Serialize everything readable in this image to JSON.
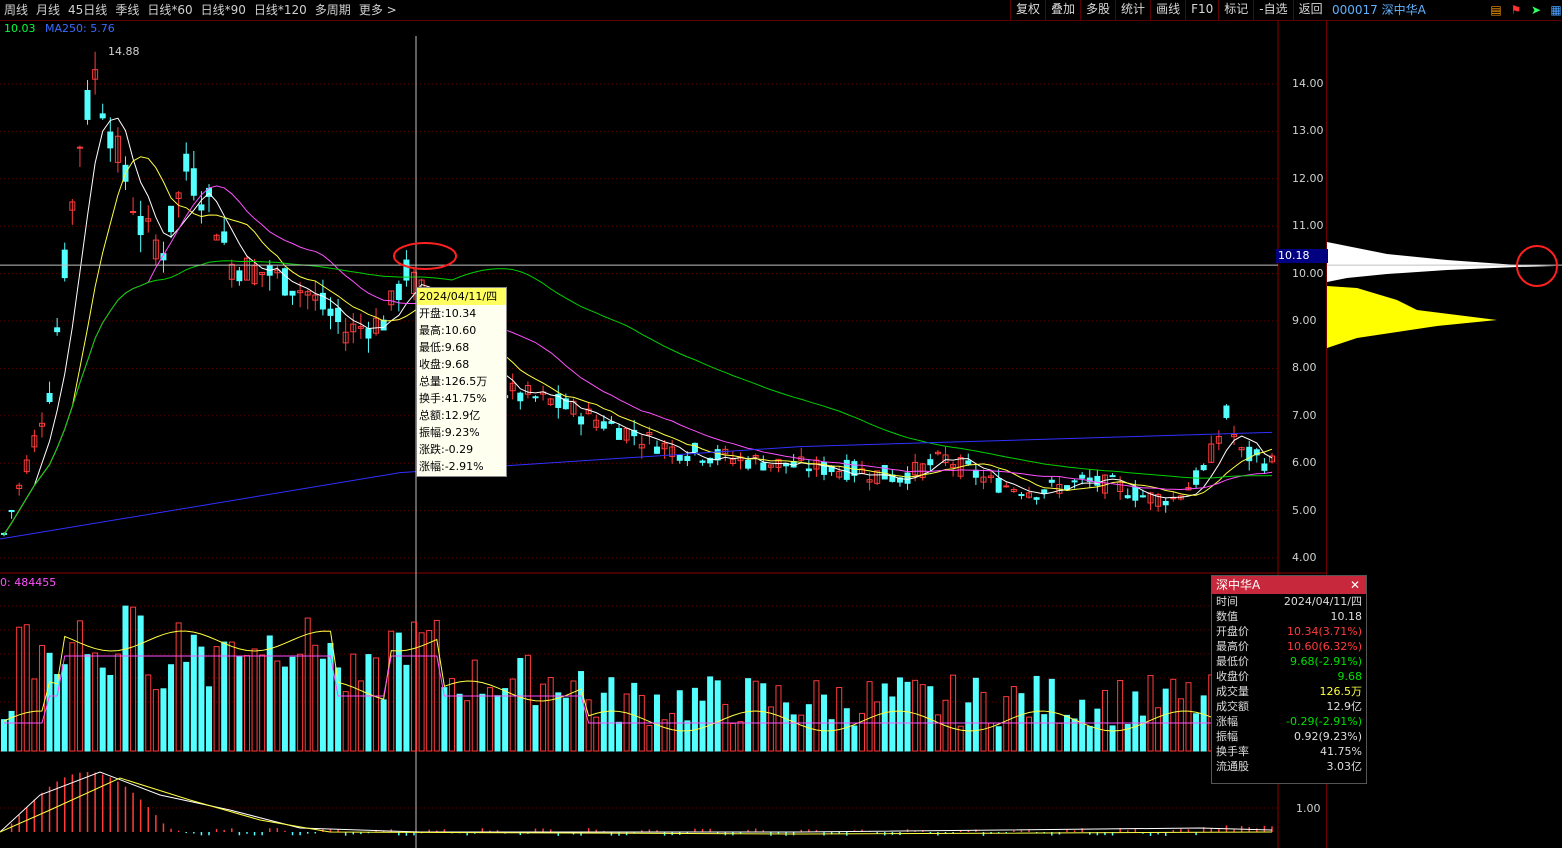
{
  "periods": [
    "周线",
    "月线",
    "45日线",
    "季线",
    "日线*60",
    "日线*90",
    "日线*120",
    "多周期",
    "更多 >"
  ],
  "toolbar": [
    "复权",
    "叠加",
    "多股",
    "统计",
    "画线",
    "F10",
    "标记",
    "-自选",
    "返回"
  ],
  "stock": {
    "code_name": "000017 深中华A"
  },
  "ma_legend": {
    "value": "10.03",
    "ma250": "MA250: 5.76"
  },
  "price_axis": [
    "14.00",
    "13.00",
    "12.00",
    "11.00",
    "10.00",
    "9.00",
    "8.00",
    "7.00",
    "6.00",
    "5.00",
    "4.00"
  ],
  "cursor_value": "10.18",
  "peak_label": "14.88",
  "volume_label": "0: 484455",
  "indicator_axis": [
    "1.00"
  ],
  "tooltip": {
    "date": "2024/04/11/四",
    "rows": [
      "开盘:10.34",
      "最高:10.60",
      "最低:9.68",
      "收盘:9.68",
      "总量:126.5万",
      "换手:41.75%",
      "总额:12.9亿",
      "振幅:9.23%",
      "涨跌:-0.29",
      "涨幅:-2.91%"
    ]
  },
  "info_panel": {
    "title": "深中华A",
    "close": "✕",
    "rows": [
      {
        "k": "时间",
        "v": "2024/04/11/四",
        "color": "#dddddd"
      },
      {
        "k": "数值",
        "v": "10.18",
        "color": "#dddddd"
      },
      {
        "k": "开盘价",
        "v": "10.34(3.71%)",
        "color": "#ff3c3c"
      },
      {
        "k": "最高价",
        "v": "10.60(6.32%)",
        "color": "#ff3c3c"
      },
      {
        "k": "最低价",
        "v": "9.68(-2.91%)",
        "color": "#00e000"
      },
      {
        "k": "收盘价",
        "v": "9.68",
        "color": "#00e000"
      },
      {
        "k": "成交量",
        "v": "126.5万",
        "color": "#ffff40"
      },
      {
        "k": "成交额",
        "v": "12.9亿",
        "color": "#dddddd"
      },
      {
        "k": "涨幅",
        "v": "-0.29(-2.91%)",
        "color": "#00e000"
      },
      {
        "k": "振幅",
        "v": "0.92(9.23%)",
        "color": "#dddddd"
      },
      {
        "k": "换手率",
        "v": "41.75%",
        "color": "#dddddd"
      },
      {
        "k": "流通股",
        "v": "3.03亿",
        "color": "#dddddd"
      }
    ]
  },
  "colors": {
    "up": "#ff3c3c",
    "down": "#54ffff",
    "ma5": "#ffffff",
    "ma10": "#ffff40",
    "ma20": "#ff50ff",
    "ma60": "#00d000",
    "ma250": "#3030ff"
  },
  "chart_data": {
    "type": "candlestick",
    "ylim": [
      4.0,
      14.9
    ],
    "last_close": 6.0,
    "selected_date": "2024/04/11"
  }
}
